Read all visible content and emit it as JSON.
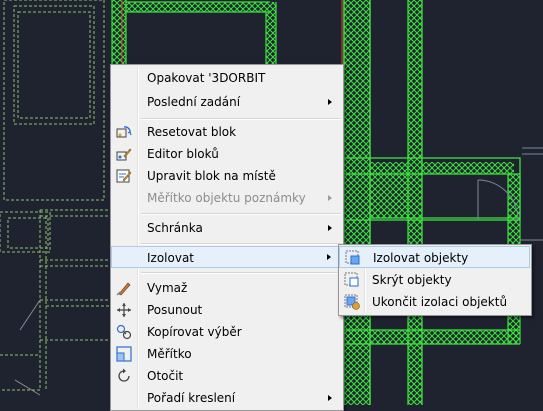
{
  "menu": {
    "items": [
      {
        "label": "Opakovat '3DORBIT",
        "icon": null,
        "submenu": false,
        "disabled": false
      },
      {
        "label": "Poslední zadání",
        "icon": null,
        "submenu": true,
        "disabled": false
      },
      {
        "label": "Resetovat blok",
        "icon": "reset-block-icon",
        "submenu": false,
        "disabled": false
      },
      {
        "label": "Editor bloků",
        "icon": "block-editor-icon",
        "submenu": false,
        "disabled": false
      },
      {
        "label": "Upravit blok na místě",
        "icon": "edit-in-place-icon",
        "submenu": false,
        "disabled": false
      },
      {
        "label": "Měřítko objektu poznámky",
        "icon": null,
        "submenu": true,
        "disabled": true
      },
      {
        "label": "Schránka",
        "icon": null,
        "submenu": true,
        "disabled": false
      },
      {
        "label": "Izolovat",
        "icon": null,
        "submenu": true,
        "disabled": false,
        "highlighted": true
      },
      {
        "label": "Vymaž",
        "icon": "erase-icon",
        "submenu": false,
        "disabled": false
      },
      {
        "label": "Posunout",
        "icon": "move-icon",
        "submenu": false,
        "disabled": false
      },
      {
        "label": "Kopírovat výběr",
        "icon": "copy-icon",
        "submenu": false,
        "disabled": false
      },
      {
        "label": "Měřítko",
        "icon": "scale-icon",
        "submenu": false,
        "disabled": false
      },
      {
        "label": "Otočit",
        "icon": "rotate-icon",
        "submenu": false,
        "disabled": false
      },
      {
        "label": "Pořadí kreslení",
        "icon": null,
        "submenu": true,
        "disabled": false
      }
    ]
  },
  "submenu": {
    "items": [
      {
        "label": "Izolovat objekty",
        "icon": "isolate-objects-icon",
        "highlighted": true
      },
      {
        "label": "Skrýt objekty",
        "icon": "hide-objects-icon"
      },
      {
        "label": "Ukončit izolaci objektů",
        "icon": "end-isolation-icon"
      }
    ]
  },
  "colors": {
    "background": "#1f2330",
    "walls": "#3ee23e",
    "red_lines": "#e04040",
    "dashed_lines": "#8dc06e",
    "menu_bg": "#f0f0f0",
    "highlight_bg": "#e5f0fb"
  }
}
